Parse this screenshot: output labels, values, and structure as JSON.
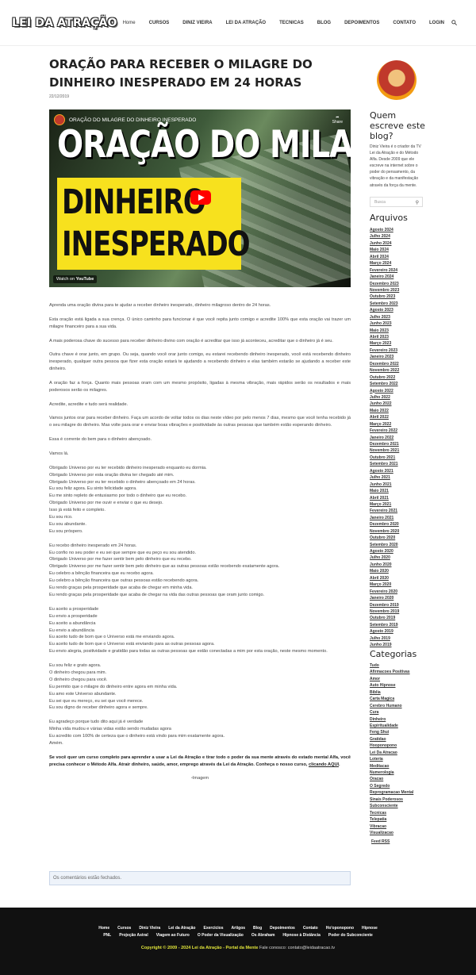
{
  "header": {
    "logo": "LEI DA ATRAÇÃO",
    "nav": [
      "Home",
      "CURSOS",
      "DINIZ VIEIRA",
      "LEI DA ATRAÇÃO",
      "TECNICAS",
      "BLOG",
      "DEPOIMENTOS",
      "CONTATO",
      "LOGIN"
    ]
  },
  "post": {
    "title": "ORAÇÃO PARA RECEBER O MILAGRE DO DINHEIRO INESPERADO EM 24 HORAS",
    "date": "22/12/2019",
    "video": {
      "channel_title": "ORAÇÃO DO MILAGRE DO DINHEIRO INESPERADO",
      "share": "Share",
      "big_line": "ORAÇÃO DO MILAGRE",
      "yellow_1": "DINHEIRO",
      "yellow_2": "INESPERADO",
      "watch_on": "Watch on",
      "youtube": "YouTube"
    },
    "paragraphs": [
      "Aprenda uma oração divina para te ajudar a receber dinheiro inesperado, dinheiro milagroso dentro de 24 horas.",
      "Esta oração está ligada a sua crença. O único caminho para funcionar é que você repita junto comigo e acredite 100% que esta oração vai trazer um milagre financeiro para a sua vida.",
      "A mais poderosa chave do sucesso para receber dinheiro divino com oração é acreditar que isso já aconteceu, acreditar que o dinheiro já é seu.",
      "Outra chave é orar junto, em grupo. Ou seja, quando você orar junto comigo, eu estarei recebendo dinheiro inesperado, você está recebendo dinheiro inesperado, qualquer outra pessoa que fizer esta oração estará te ajudando a recebendo dinheiro e elas também estarão se ajudando a receber este dinheiro.",
      "A oração faz a força. Quanto mais pessoas oram com um mesmo propósito, ligadas à mesma vibração, mais rápidos serão os resultados e mais poderosos serão os milagres.",
      "Acredite, acredite e tudo será realidade.",
      "Vamos juntos orar para receber dinheiro. Faça um acordo de voltar todos os dias neste vídeo por pelo menos 7 dias, mesmo que você tenha recebido já o seu milagre do dinheiro. Mas volte para orar e enviar boas vibrações e positividade às outras pessoas que também estão esperando dinheiro.",
      "Essa é corrente do bem para o dinheiro abençoado.",
      "Vamos lá."
    ],
    "prayer_blocks": [
      [
        "Obrigado Universo por eu ter recebido dinheiro inesperado enquanto eu dormia.",
        "Obrigado Universo por esta oração divina ter chegado até mim.",
        "Obrigado Universo por eu ter recebido o dinheiro abençoado em 24 horas.",
        "Eu sou feliz agora. Eu sinto felicidade agora.",
        "Eu me sinto repleto de entusiasmo por todo o dinheiro que eu recebo.",
        "Obrigado Universo por me ouvir e enviar o que eu desejo.",
        "Isso já está feito e completo.",
        "Eu sou rico.",
        "Eu sou abundante.",
        "Eu sou próspero."
      ],
      [
        "Eu recebo dinheiro inesperado em 24 horas.",
        "Eu confio no seu poder e eu sei que sempre que eu peço eu sou atendido.",
        "Obrigado Universo por me fazer sentir bem pelo dinheiro que eu recebo.",
        "Obrigado Universo por me fazer sentir bem pelo dinheiro que as outras pessoas estão recebendo exatamente agora.",
        "Eu celebro a bênção financeira que eu recebo agora.",
        "Eu celebro a bênção financeira que outras pessoas estão recebendo agora.",
        "Eu rendo graças pela prosperidade que acaba de chegar em minha vida.",
        "Eu rendo graças pela prosperidade que acaba de chegar na vida das outras pessoas que oram junto comigo."
      ],
      [
        "Eu aceito a prosperidade",
        "Eu envio a prosperidade",
        "Eu aceito a abundância",
        "Eu envio a abundância",
        "Eu aceito tudo de bom que o Universo está me enviando agora.",
        "Eu aceito tudo de bom que o Universo está enviando para as outras pessoas agora.",
        "Eu envio alegria, positividade e gratidão para todas as outras pessoas que estão conectadas a mim por esta oração, neste mesmo momento."
      ],
      [
        "Eu sou feliz e grato agora.",
        "O dinheiro chegou para mim.",
        "O dinheiro chegou para você.",
        "Eu permito que o milagre do dinheiro entre agora em minha vida.",
        "Eu amo este Universo abundante.",
        "Eu sei que eu mereço, eu sei que você merece.",
        "Eu sou digno de receber dinheiro agora e sempre."
      ],
      [
        "Eu agradeço porque tudo dito aqui já é verdade",
        "Minha vida mudou e várias vidas estão sendo mudadas agora",
        "Eu acredito com 100% de certeza que o dinheiro está vindo para mim exatamente agora.",
        "Amém."
      ]
    ],
    "cta_text": "Se você quer um curso completo para aprender a usar a Lei da Atração e tirar todo o poder da sua mente através do estado mental Alfa, você precisa conhecer o Método Alfa. Atrair dinheiro, saúde, amor, emprego através da Lei da Atração. Conheça o nosso curso, ",
    "cta_link": "clicando AQUI",
    "image_alt": "Imagem",
    "comments_closed": "Os comentários estão fechados."
  },
  "sidebar": {
    "about_title": "Quem escreve este blog?",
    "about_text": "Diniz Vieira é o criador da TV Lei da Atração e do Método Alfa. Desde 2009 que ele escreve na internet sobre o poder do pensamento, da vibração e da manifestação através da força da mente.",
    "search_placeholder": "Busca",
    "archives_title": "Arquivos",
    "archives": [
      "Agosto 2024",
      "Julho 2024",
      "Junho 2024",
      "Maio 2024",
      "Abril 2024",
      "Março 2024",
      "Fevereiro 2024",
      "Janeiro 2024",
      "Dezembro 2023",
      "Novembro 2023",
      "Outubro 2023",
      "Setembro 2023",
      "Agosto 2023",
      "Julho 2023",
      "Junho 2023",
      "Maio 2023",
      "Abril 2023",
      "Março 2023",
      "Fevereiro 2023",
      "Janeiro 2023",
      "Dezembro 2022",
      "Novembro 2022",
      "Outubro 2022",
      "Setembro 2022",
      "Agosto 2022",
      "Julho 2022",
      "Junho 2022",
      "Maio 2022",
      "Abril 2022",
      "Março 2022",
      "Fevereiro 2022",
      "Janeiro 2022",
      "Dezembro 2021",
      "Novembro 2021",
      "Outubro 2021",
      "Setembro 2021",
      "Agosto 2021",
      "Julho 2021",
      "Junho 2021",
      "Maio 2021",
      "Abril 2021",
      "Março 2021",
      "Fevereiro 2021",
      "Janeiro 2021",
      "Dezembro 2020",
      "Novembro 2020",
      "Outubro 2020",
      "Setembro 2020",
      "Agosto 2020",
      "Julho 2020",
      "Junho 2020",
      "Maio 2020",
      "Abril 2020",
      "Março 2020",
      "Fevereiro 2020",
      "Janeiro 2020",
      "Dezembro 2019",
      "Novembro 2019",
      "Outubro 2019",
      "Setembro 2019",
      "Agosto 2019",
      "Julho 2019",
      "Junho 2019"
    ],
    "categories_title": "Categorias",
    "categories": [
      "Tudo",
      "Afirmacoes Positivas",
      "Amor",
      "Auto Hipnose",
      "Biblia",
      "Carta Magica",
      "Cerebro Humano",
      "Cura",
      "Dinheiro",
      "Espiritualidade",
      "Feng Shui",
      "Gratidao",
      "Hooponopono",
      "Lei Da Atracao",
      "Loteria",
      "Meditacao",
      "Numerologia",
      "Oracao",
      "O Segredo",
      "Reprogramacao Mental",
      "Sinais Poderosos",
      "Subconsciente",
      "Tecnicas",
      "Telepatia",
      "Vibracao",
      "Visualizacao"
    ],
    "feed": "Feed RSS"
  },
  "footer": {
    "nav_row1": [
      "Home",
      "Cursos",
      "Diniz Vieira",
      "Lei da Atração",
      "Exercicios",
      "Artigos",
      "Blog",
      "Depoimentos",
      "Contato",
      "Ho'oponopono",
      "Hipnose"
    ],
    "nav_row2": [
      "PNL",
      "Projeção Astral",
      "Viagem ao Futuro",
      "O Poder da Visualização",
      "Os Abraham",
      "Hipnose à Distância",
      "Poder do Subconciente"
    ],
    "copyright": "Copyright © 2009 - 2024 Lei da Atração - Portal da Mente",
    "contact": "Fale conosco: contato@leidaatracao.tv"
  }
}
